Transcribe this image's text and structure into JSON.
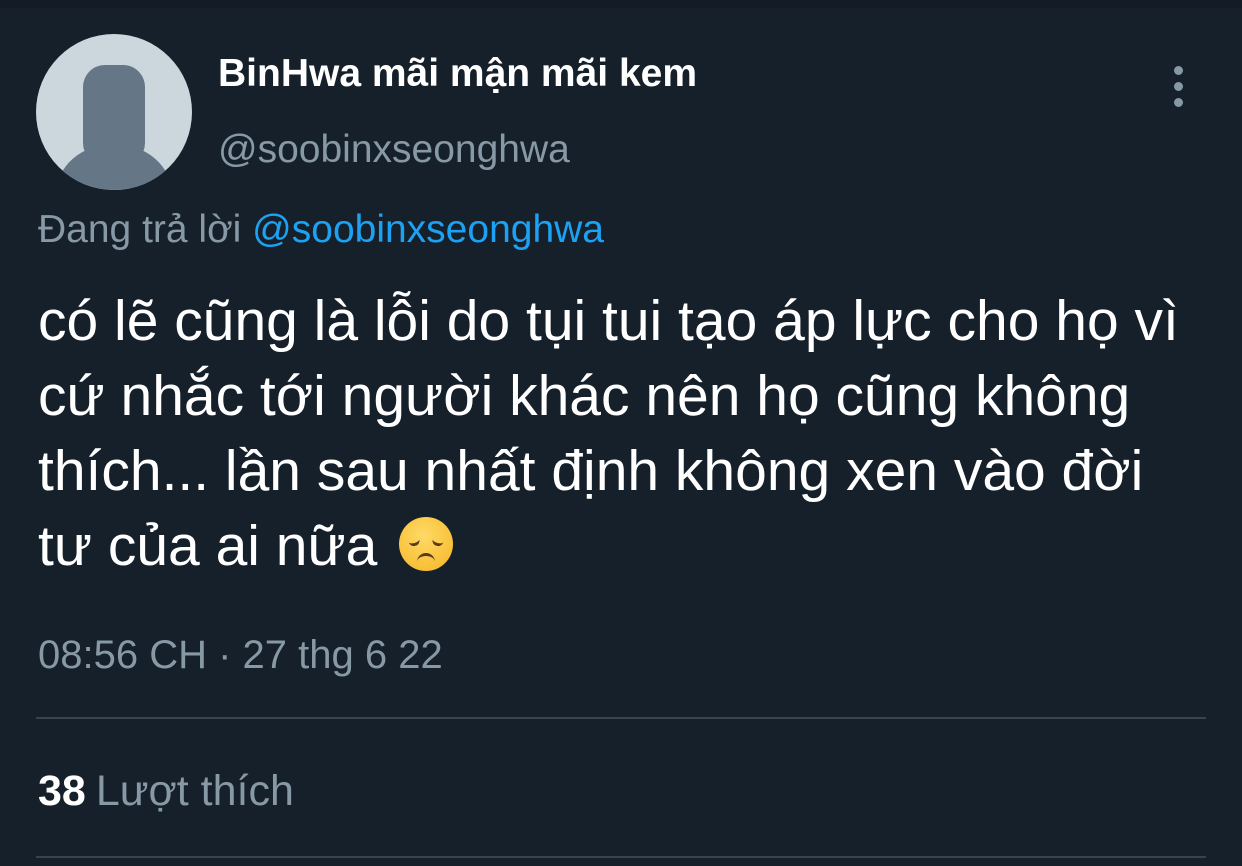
{
  "tweet": {
    "author": {
      "display_name": "BinHwa mãi mận mãi kem",
      "handle": "@soobinxseonghwa",
      "avatar_icon": "default-avatar-icon"
    },
    "reply": {
      "prefix": "Đang trả lời",
      "mention": "@soobinxseonghwa"
    },
    "text": "có lẽ cũng là lỗi do tụi tui tạo áp lực cho họ vì cứ nhắc tới người khác nên họ cũng không thích... lần sau nhất định không xen vào đời tư của ai nữa",
    "emoji": "disappointed-face",
    "timestamp": "08:56 CH · 27 thg 6 22",
    "stats": {
      "likes_count": "38",
      "likes_label": "Lượt thích"
    },
    "more_icon": "more-vertical-icon"
  },
  "colors": {
    "background": "#15202b",
    "text": "#ffffff",
    "secondary": "#8899a6",
    "accent": "#1da1f2",
    "divider": "#38444d"
  }
}
